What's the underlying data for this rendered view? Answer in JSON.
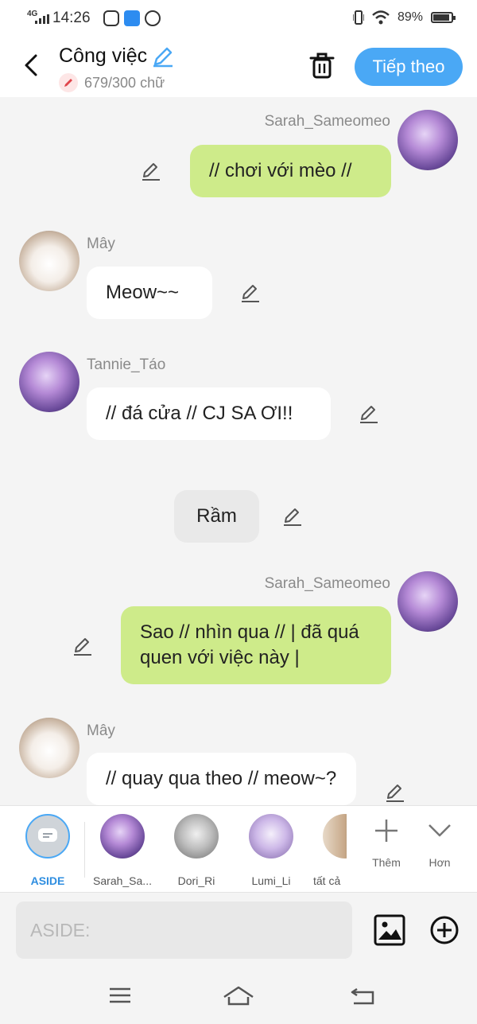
{
  "status": {
    "net": "4G",
    "time": "14:26",
    "battery_text": "89%",
    "battery_level": 0.89
  },
  "header": {
    "title": "Công việc",
    "char_count": "679/300 chữ",
    "next_label": "Tiếp theo"
  },
  "messages": [
    {
      "type": "sent",
      "name": "Sarah_Sameomeo",
      "text": "// chơi với mèo //"
    },
    {
      "type": "received",
      "name": "Mây",
      "text": "Meow~~"
    },
    {
      "type": "received",
      "name": "Tannie_Táo",
      "text": "// đá cửa // CJ SA ƠI!!"
    },
    {
      "type": "narration",
      "text": "Rầm"
    },
    {
      "type": "sent",
      "name": "Sarah_Sameomeo",
      "text": "Sao // nhìn qua // | đã quá quen với việc này |"
    },
    {
      "type": "received",
      "name": "Mây",
      "text": "// quay qua theo // meow~?"
    }
  ],
  "characters": [
    {
      "label": "ASIDE"
    },
    {
      "label": "Sarah_Sa..."
    },
    {
      "label": "Dori_Ri"
    },
    {
      "label": "Lumi_Li"
    },
    {
      "label": "tất cả"
    }
  ],
  "tools": {
    "add_label": "Thêm",
    "more_label": "Hơn"
  },
  "input": {
    "placeholder": "ASIDE:"
  },
  "colors": {
    "accent": "#4aa8f5",
    "sent_bubble": "#ceeb8a",
    "received_bubble": "#ffffff",
    "narration_bubble": "#e9e9e9"
  }
}
